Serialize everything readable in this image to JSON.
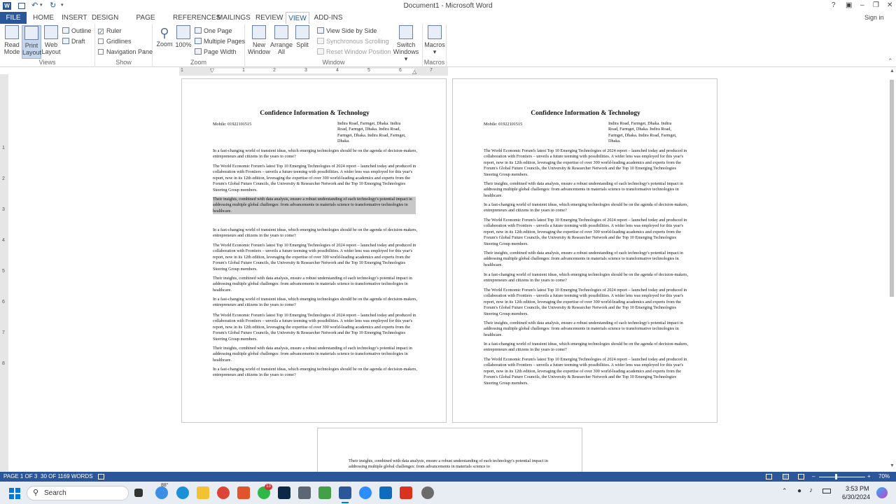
{
  "window": {
    "title": "Document1 - Microsoft Word",
    "sign_in": "Sign in"
  },
  "ribbon_tabs": [
    {
      "label": "FILE"
    },
    {
      "label": "HOME"
    },
    {
      "label": "INSERT"
    },
    {
      "label": "DESIGN"
    },
    {
      "label": "PAGE LAYOUT"
    },
    {
      "label": "REFERENCES"
    },
    {
      "label": "MAILINGS"
    },
    {
      "label": "REVIEW"
    },
    {
      "label": "VIEW"
    },
    {
      "label": "ADD-INS"
    }
  ],
  "views_group": {
    "label": "Views",
    "read_mode": "Read\nMode",
    "read_mode_1": "Read",
    "read_mode_2": "Mode",
    "print_1": "Print",
    "print_2": "Layout",
    "web_1": "Web",
    "web_2": "Layout",
    "outline": "Outline",
    "draft": "Draft"
  },
  "show_group": {
    "label": "Show",
    "ruler": "Ruler",
    "gridlines": "Gridlines",
    "navigation": "Navigation Pane"
  },
  "zoom_group": {
    "label": "Zoom",
    "zoom": "Zoom",
    "hundred": "100%",
    "one_page": "One Page",
    "multiple_pages": "Multiple Pages",
    "page_width": "Page Width"
  },
  "window_group": {
    "label": "Window",
    "new_1": "New",
    "new_2": "Window",
    "arrange_1": "Arrange",
    "arrange_2": "All",
    "split": "Split",
    "side_by_side": "View Side by Side",
    "sync_scroll": "Synchronous Scrolling",
    "reset_window": "Reset Window Position",
    "switch_1": "Switch",
    "switch_2": "Windows ▾"
  },
  "macros_group": {
    "label": "Macros",
    "macros": "Macros"
  },
  "ruler_ticks": [
    "1",
    "1",
    "2",
    "3",
    "4",
    "5",
    "6",
    "7"
  ],
  "vruler_ticks": [
    "1",
    "2",
    "3",
    "4",
    "5",
    "6",
    "7",
    "8"
  ],
  "doc": {
    "heading": "Confidence Information & Technology",
    "mobile": "Mobile: 01922101515",
    "address_l1": "Indira Road, Farmget, Dhaka. Indira",
    "address_l2": "Road, Farmget, Dhaka. Indira Road,",
    "address_l3": "Farmget, Dhaka. Indira Road, Farmget,",
    "address_l4": "Dhaka.",
    "para_a": "In a fast-changing world of transient ideas, which emerging technologies should be on the agenda of decision-makers, entrepreneurs and citizens in the years to come?",
    "para_b": "The World Economic Forum's latest Top 10 Emerging Technologies of 2024 report – launched today and produced in collaboration with Frontiers – unveils a future teeming with possibilities. A wider lens was employed for this year's report, now in its 12th edition, leveraging the expertise of over 300 world-leading academics and experts from the Forum's Global Future Councils, the University & Researcher Network and the Top 10 Emerging Technologies Steering Group members.",
    "para_c": "Their insights, combined with data analysis, ensure a robust understanding of each technology's potential impact in addressing multiple global challenges: from advancements in materials science to transformative technologies in healthcare.",
    "para_c_partial": "Their insights, combined with data analysis, ensure a robust understanding of each technology's potential impact in addressing multiple global challenges: from advancements in materials science to"
  },
  "status": {
    "page": "PAGE 1 OF 3",
    "words": "30 OF 1169 WORDS",
    "zoom": "70%"
  },
  "taskbar": {
    "search": "Search",
    "temp": "88°",
    "badge": "13",
    "time": "3:53 PM",
    "date": "6/30/2024"
  },
  "colors": {
    "accent": "#2b579a",
    "selection": "#c8c8c8"
  }
}
